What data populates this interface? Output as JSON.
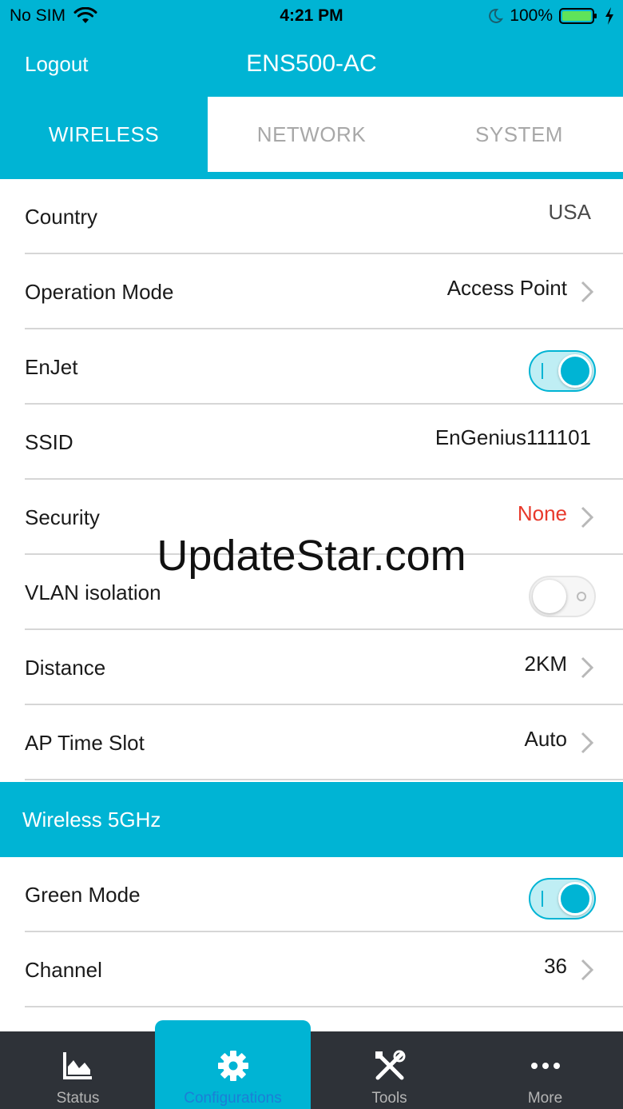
{
  "status_bar": {
    "carrier": "No SIM",
    "time": "4:21 PM",
    "battery": "100%"
  },
  "nav": {
    "logout_label": "Logout",
    "title": "ENS500-AC"
  },
  "tabs": [
    {
      "label": "WIRELESS",
      "active": true
    },
    {
      "label": "NETWORK",
      "active": false
    },
    {
      "label": "SYSTEM",
      "active": false
    }
  ],
  "rows": [
    {
      "label": "Country",
      "value": "USA",
      "kind": "value"
    },
    {
      "label": "Operation Mode",
      "value": "Access Point",
      "kind": "chevron"
    },
    {
      "label": "EnJet",
      "toggle": true,
      "kind": "toggle"
    },
    {
      "label": "SSID",
      "value": "EnGenius111101",
      "kind": "value"
    },
    {
      "label": "Security",
      "value": "None",
      "kind": "chevron"
    },
    {
      "label": "VLAN isolation",
      "toggle": false,
      "kind": "toggle"
    },
    {
      "label": "Distance",
      "value": "2KM",
      "kind": "chevron"
    },
    {
      "label": "AP Time Slot",
      "value": "Auto",
      "kind": "chevron"
    }
  ],
  "section": {
    "title": "Wireless 5GHz",
    "rows": [
      {
        "label": "Green Mode",
        "toggle": true,
        "kind": "toggle"
      },
      {
        "label": "Channel",
        "value": "36",
        "kind": "chevron"
      }
    ]
  },
  "watermark": "UpdateStar.com",
  "tab_bar": [
    {
      "label": "Status",
      "icon": "chart-icon",
      "active": false
    },
    {
      "label": "Configurations",
      "icon": "gear-icon",
      "active": true
    },
    {
      "label": "Tools",
      "icon": "tools-icon",
      "active": false
    },
    {
      "label": "More",
      "icon": "more-icon",
      "active": false
    }
  ],
  "colors": {
    "accent": "#00b4d4",
    "alert": "#e8392b",
    "tab_bar_bg": "#2e3238",
    "active_tab_label": "#1b7fd6"
  }
}
